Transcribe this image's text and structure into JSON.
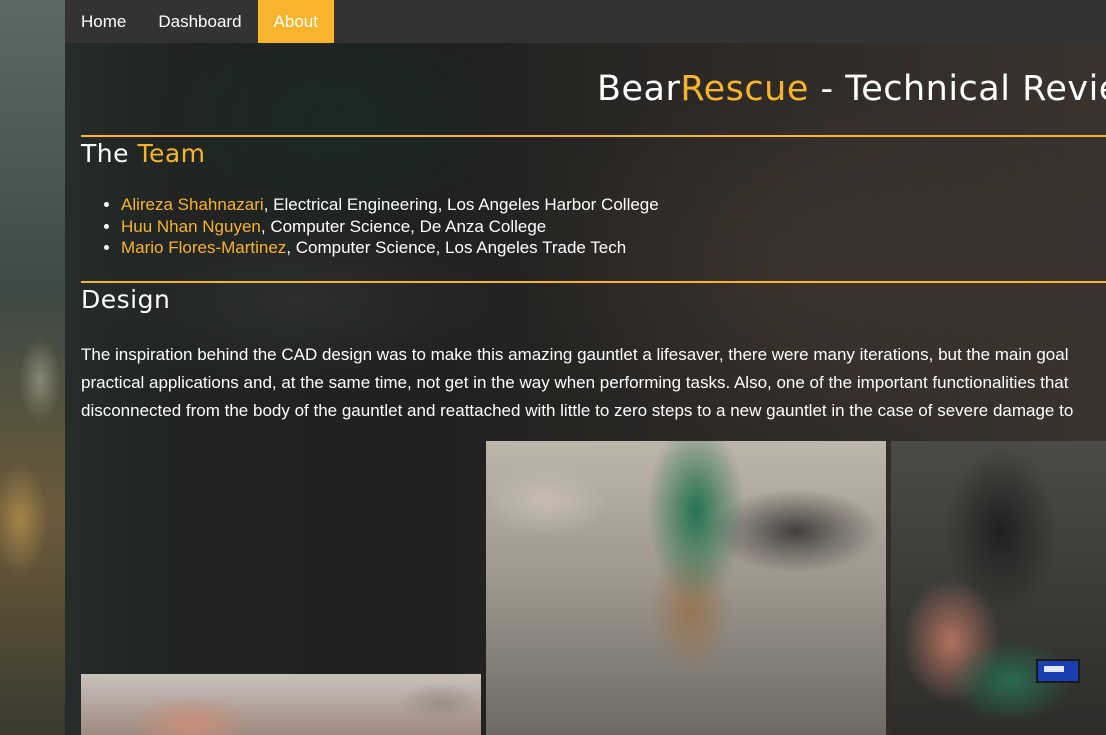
{
  "nav": {
    "items": [
      {
        "label": "Home"
      },
      {
        "label": "Dashboard"
      },
      {
        "label": "About",
        "active": true
      }
    ]
  },
  "header": {
    "title_part1": "Bear",
    "title_part2": "Rescue",
    "title_part3": " - Technical Review"
  },
  "team": {
    "heading_part1": "The ",
    "heading_part2": "Team",
    "members": [
      {
        "name": "Alireza Shahnazari",
        "details": ", Electrical Engineering, Los Angeles Harbor College"
      },
      {
        "name": "Huu Nhan Nguyen",
        "details": ", Computer Science, De Anza College"
      },
      {
        "name": "Mario Flores-Martinez",
        "details": ", Computer Science, Los Angeles Trade Tech"
      }
    ]
  },
  "design": {
    "heading": "Design",
    "lines": [
      "The inspiration behind the CAD design was to make this amazing gauntlet a lifesaver, there were many iterations, but the main goal",
      "practical applications and, at the same time, not get in the way when performing tasks. Also, one of the important functionalities that",
      "disconnected from the body of the gauntlet and reattached with little to zero steps to a new gauntlet in the case of severe damage to"
    ]
  },
  "colors": {
    "accent": "#f7b42c",
    "nav_bg": "#333333",
    "text": "#ffffff"
  }
}
